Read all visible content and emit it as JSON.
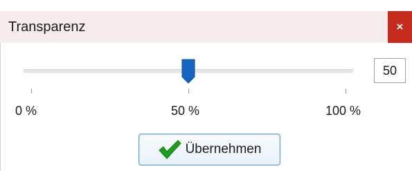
{
  "window": {
    "title": "Transparenz",
    "close_label": "×"
  },
  "slider": {
    "value_percent": 50,
    "min_percent": 0,
    "max_percent": 100,
    "tick_labels": [
      "0 %",
      "50 %",
      "100 %"
    ],
    "thumb_color": "#1565c0"
  },
  "value_field": {
    "value": "50"
  },
  "apply_button": {
    "label": "Übernehmen",
    "icon": "checkmark-icon",
    "icon_color": "#1b9e1b"
  }
}
